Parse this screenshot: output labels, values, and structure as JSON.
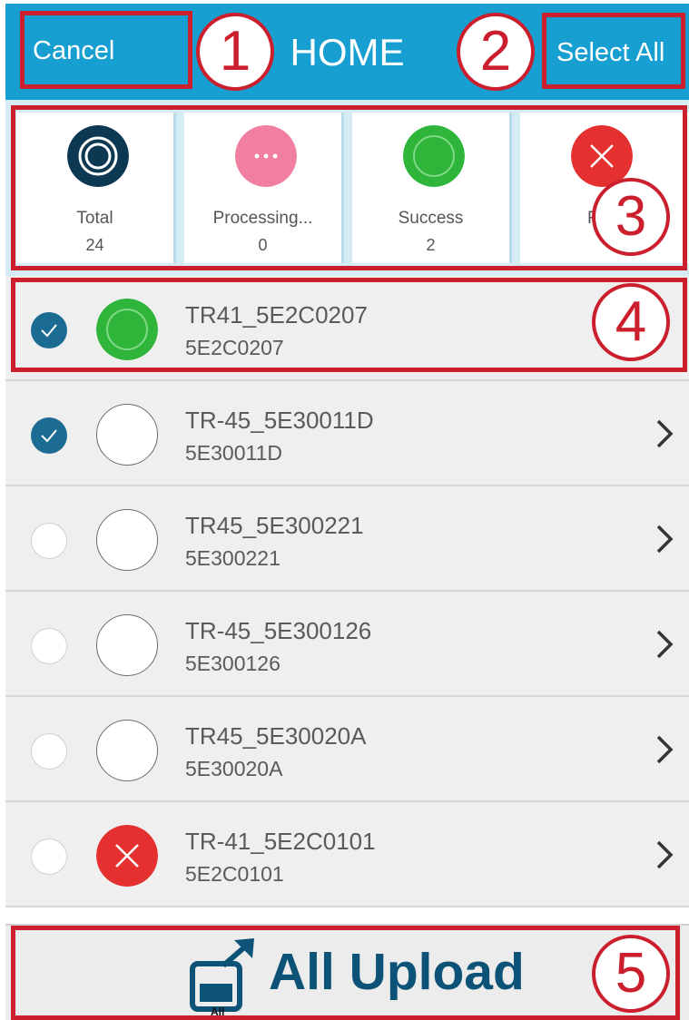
{
  "header": {
    "cancel_label": "Cancel",
    "title": "HOME",
    "select_all_label": "Select All",
    "bg_color": "#169fd0"
  },
  "summary": [
    {
      "label": "Total",
      "count": "24",
      "icon": "total-rings-icon",
      "color": "#0d3852"
    },
    {
      "label": "Processing...",
      "count": "0",
      "icon": "processing-dots-icon",
      "color": "#f07fa0"
    },
    {
      "label": "Success",
      "count": "2",
      "icon": "success-ring-icon",
      "color": "#2eb53a"
    },
    {
      "label": "Fa",
      "count": "",
      "icon": "fail-x-icon",
      "color": "#e53030"
    }
  ],
  "devices": [
    {
      "name": "TR41_5E2C0207",
      "id": "5E2C0207",
      "checked": true,
      "status": "success",
      "chevron": false
    },
    {
      "name": "TR-45_5E30011D",
      "id": "5E30011D",
      "checked": true,
      "status": "none",
      "chevron": true
    },
    {
      "name": "TR45_5E300221",
      "id": "5E300221",
      "checked": false,
      "status": "none",
      "chevron": true
    },
    {
      "name": "TR-45_5E300126",
      "id": "5E300126",
      "checked": false,
      "status": "none",
      "chevron": true
    },
    {
      "name": "TR45_5E30020A",
      "id": "5E30020A",
      "checked": false,
      "status": "none",
      "chevron": true
    },
    {
      "name": "TR-41_5E2C0101",
      "id": "5E2C0101",
      "checked": false,
      "status": "fail",
      "chevron": true
    }
  ],
  "upload": {
    "label": "All Upload",
    "icon_caption": "All",
    "icon": "upload-arrow-icon",
    "text_color": "#0d5277"
  },
  "annotations": [
    "1",
    "2",
    "3",
    "4",
    "5"
  ],
  "annotation_color": "#cc1f2d"
}
